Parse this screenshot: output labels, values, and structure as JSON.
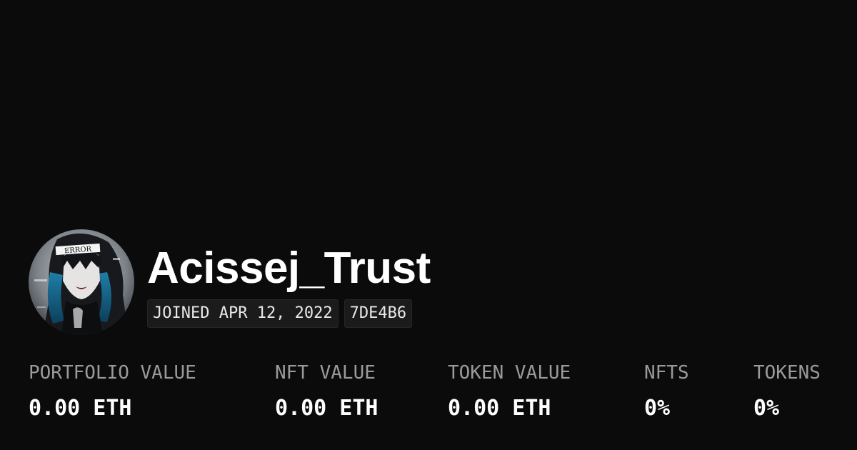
{
  "profile": {
    "name": "Acissej_Trust",
    "joined": "JOINED APR 12, 2022",
    "address_short": "7DE4B6",
    "avatar_icon": "anime-avatar-image",
    "avatar_text": "ERROR"
  },
  "stats": [
    {
      "label": "PORTFOLIO VALUE",
      "value": "0.00 ETH"
    },
    {
      "label": "NFT VALUE",
      "value": "0.00 ETH"
    },
    {
      "label": "TOKEN VALUE",
      "value": "0.00 ETH"
    },
    {
      "label": "NFTS",
      "value": "0%"
    },
    {
      "label": "TOKENS",
      "value": "0%"
    }
  ],
  "colors": {
    "background": "#0b0b0b",
    "text": "#ffffff",
    "label": "#9a9a9a",
    "badge_bg": "#1b1b1b"
  }
}
